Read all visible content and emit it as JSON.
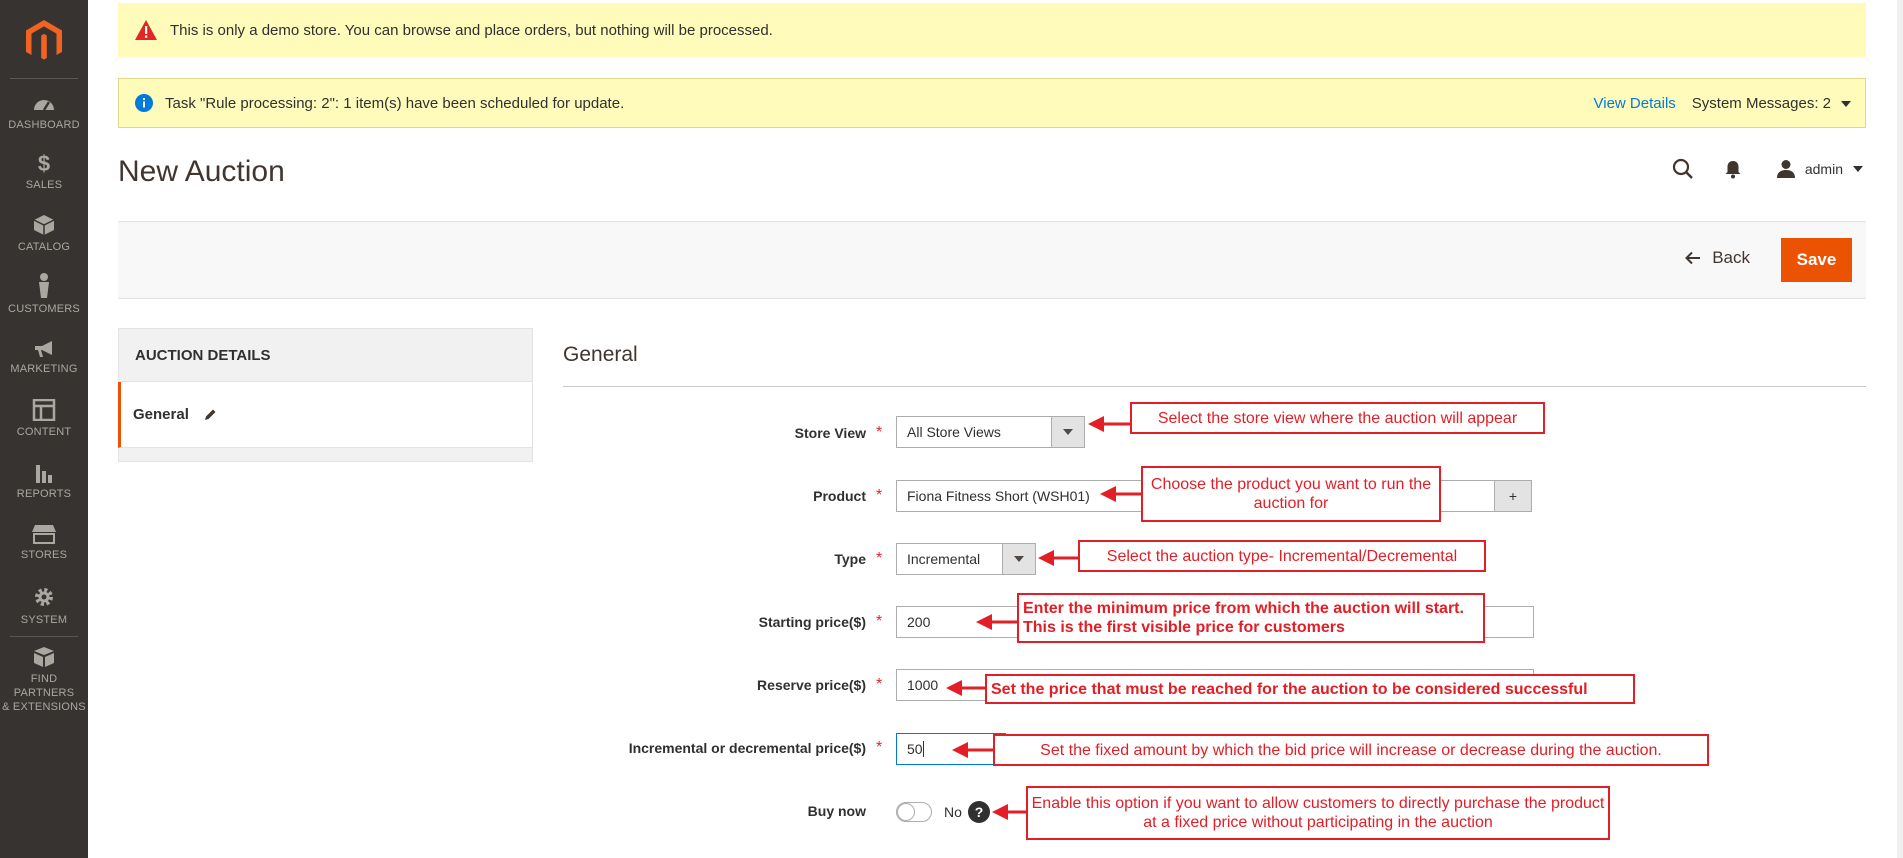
{
  "sidebar": {
    "items": [
      {
        "label": "DASHBOARD",
        "icon": "dashboard-icon"
      },
      {
        "label": "SALES",
        "icon": "dollar-icon"
      },
      {
        "label": "CATALOG",
        "icon": "box-icon"
      },
      {
        "label": "CUSTOMERS",
        "icon": "person-icon"
      },
      {
        "label": "MARKETING",
        "icon": "megaphone-icon"
      },
      {
        "label": "CONTENT",
        "icon": "layout-icon"
      },
      {
        "label": "REPORTS",
        "icon": "bar-chart-icon"
      },
      {
        "label": "STORES",
        "icon": "storefront-icon"
      },
      {
        "label": "SYSTEM",
        "icon": "gear-icon"
      },
      {
        "label": "FIND PARTNERS",
        "label2": "& EXTENSIONS",
        "icon": "cubes-icon"
      }
    ]
  },
  "demo_notice": "This is only a demo store. You can browse and place orders, but nothing will be processed.",
  "system_message": {
    "text": "Task \"Rule processing: 2\": 1 item(s) have been scheduled for update.",
    "view_details": "View Details",
    "system_messages": "System Messages: 2"
  },
  "page": {
    "title": "New Auction",
    "user": "admin"
  },
  "actions": {
    "back": "Back",
    "save": "Save"
  },
  "tabs": {
    "header": "AUCTION DETAILS",
    "items": [
      "General"
    ]
  },
  "form": {
    "section_title": "General",
    "fields": {
      "store_view": {
        "label": "Store View",
        "value": "All Store Views"
      },
      "product": {
        "label": "Product",
        "value": "Fiona Fitness Short (WSH01)",
        "plus": "+"
      },
      "type": {
        "label": "Type",
        "value": "Incremental"
      },
      "starting_price": {
        "label": "Starting price($)",
        "value": "200"
      },
      "reserve_price": {
        "label": "Reserve price($)",
        "value": "1000"
      },
      "inc_dec_price": {
        "label": "Incremental or decremental price($)",
        "value": "50"
      },
      "buy_now": {
        "label": "Buy now",
        "value": "No",
        "help": "?"
      }
    },
    "required_mark": "*"
  },
  "annotations": [
    "Select the store view where the auction will appear",
    "Choose the product you want to run the auction for",
    "Select the auction type- Incremental/Decremental",
    "Enter the minimum price from which the auction will start. This is the first visible price for customers",
    "Set the price that must be reached for the auction to be considered successful",
    "Set the fixed amount by which the bid price will increase or decrease during the auction.",
    "Enable this option if you want to allow customers to directly purchase the product at a fixed price without participating in the auction"
  ],
  "colors": {
    "sidebar_bg": "#373330",
    "accent": "#eb5202",
    "notice_bg": "#fffbbb",
    "link": "#007bdb",
    "annotation": "#e21e26"
  }
}
